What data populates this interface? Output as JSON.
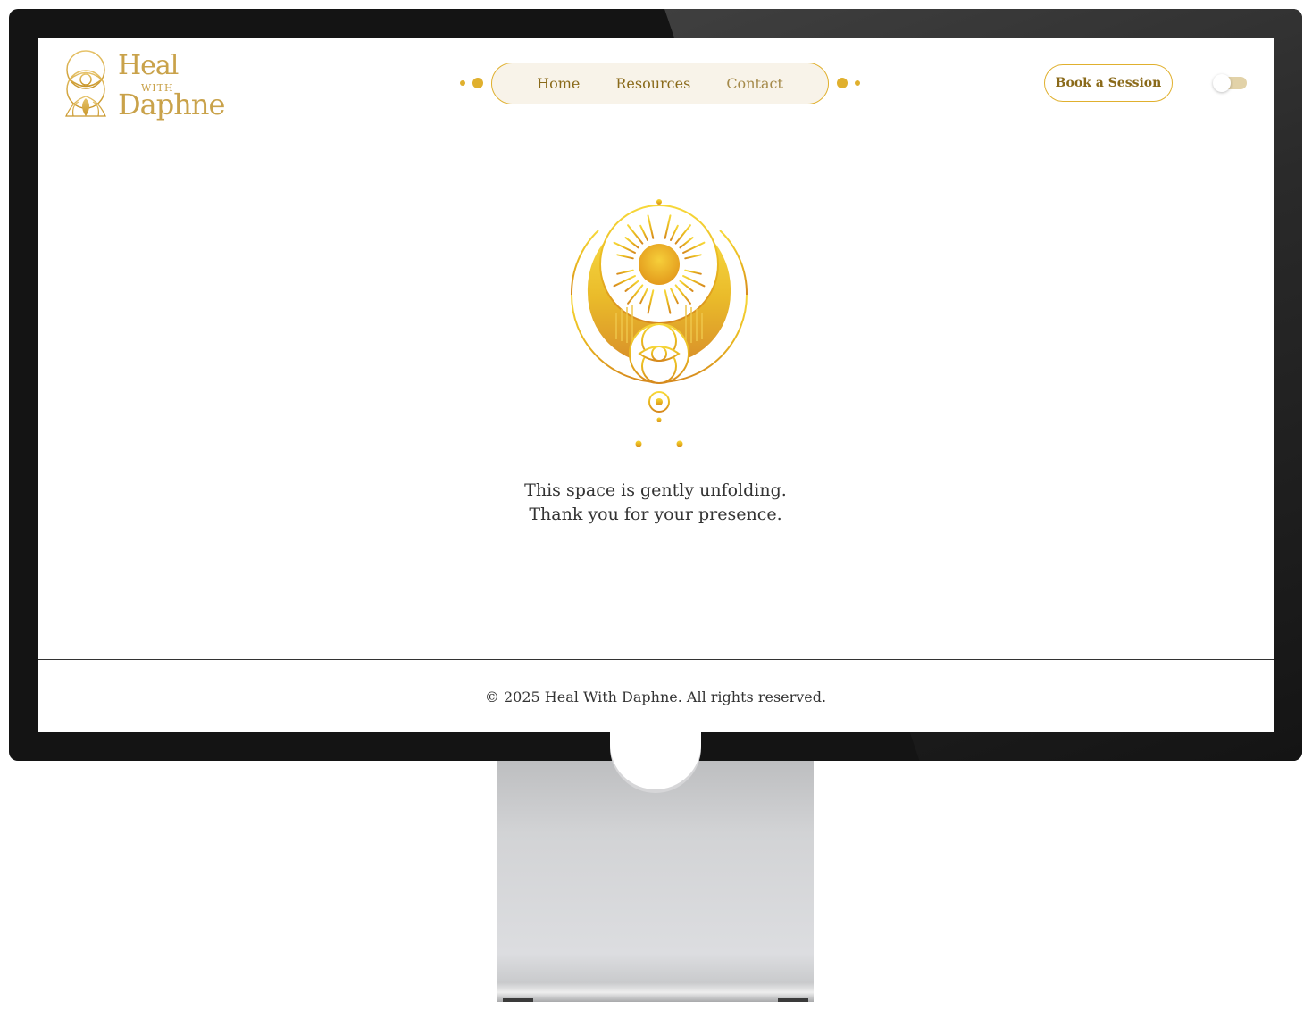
{
  "brand": {
    "logo_heal": "Heal",
    "logo_with": "WITH",
    "logo_daphne": "Daphne",
    "gold": "#e0b02e",
    "gold_dark": "#8a6a1a"
  },
  "nav": {
    "items": [
      {
        "label": "Home"
      },
      {
        "label": "Resources"
      },
      {
        "label": "Contact"
      }
    ]
  },
  "header": {
    "cta_label": "Book a Session",
    "theme_toggle": "off"
  },
  "main": {
    "emblem_icon": "sun-moon-eye-emblem-icon",
    "message_line1": "This space is gently unfolding.",
    "message_line2": "Thank you for your presence."
  },
  "footer": {
    "copyright": "© 2025 Heal With Daphne. All rights reserved."
  }
}
